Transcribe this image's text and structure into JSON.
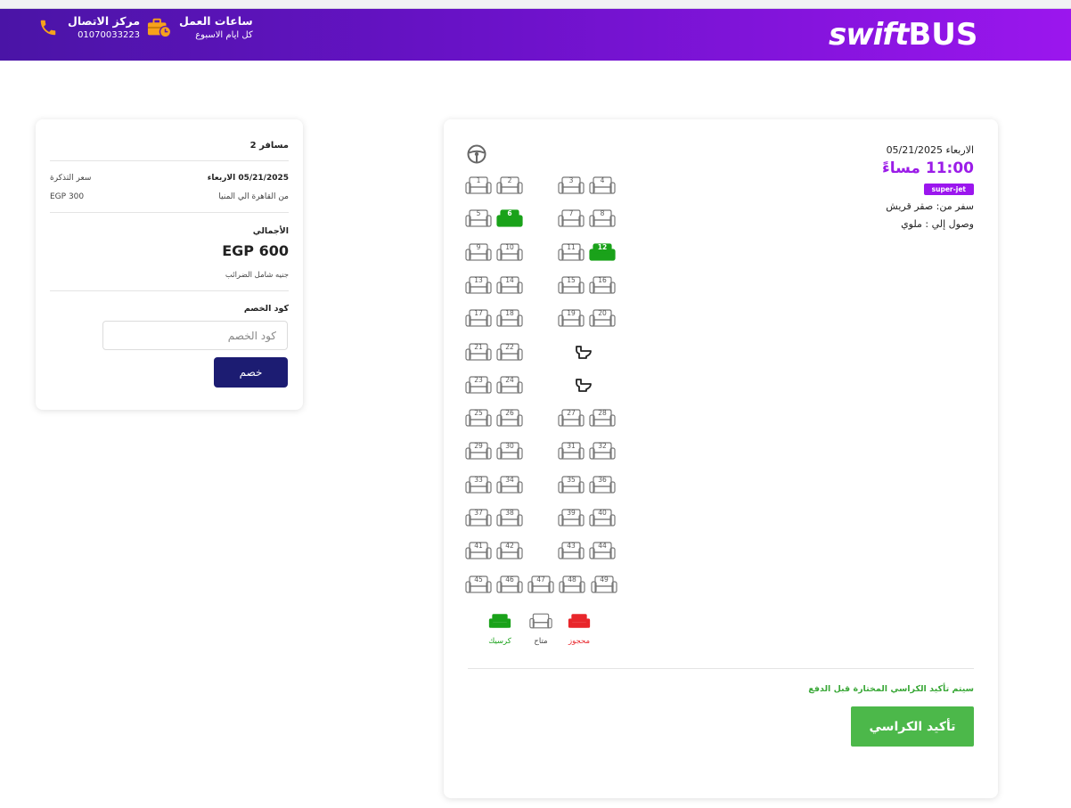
{
  "brand": {
    "logo_text_1": "swift",
    "logo_text_2": "BUS"
  },
  "header": {
    "contact_title": "مركز الاتصال",
    "contact_phone": "01070033223",
    "hours_title": "ساعات العمل",
    "hours_sub": "كل ايام الاسبوع"
  },
  "summary": {
    "passengers": "2 مسافر",
    "date": "05/21/2025 الاربعاء",
    "ticket_price_label": "سعر التذكرة",
    "route": "من القاهرة الي المنيا",
    "ticket_price": "EGP 300",
    "total_label": "الأجمالي",
    "total_value": "EGP 600",
    "tax_note": "جنيه شامل الضرائب",
    "discount_label": "كود الخصم",
    "discount_placeholder": "كود الخصم",
    "discount_button": "خصم"
  },
  "trip": {
    "day": "الاربعاء 05/21/2025",
    "time": "11:00 مساءً",
    "bus_type": "super-jet",
    "from": "سفر من: صقر قريش",
    "to": "وصول إلي : ملوي"
  },
  "seats": {
    "selected": [
      "6",
      "12"
    ],
    "rows": [
      [
        "1",
        "2",
        "",
        "3",
        "4"
      ],
      [
        "5",
        "6",
        "",
        "7",
        "8"
      ],
      [
        "9",
        "10",
        "",
        "11",
        "12"
      ],
      [
        "13",
        "14",
        "",
        "15",
        "16"
      ],
      [
        "17",
        "18",
        "",
        "19",
        "20"
      ],
      [
        "21",
        "22",
        "",
        "WC",
        ""
      ],
      [
        "23",
        "24",
        "",
        "WC",
        ""
      ],
      [
        "25",
        "26",
        "",
        "27",
        "28"
      ],
      [
        "29",
        "30",
        "",
        "31",
        "32"
      ],
      [
        "33",
        "34",
        "",
        "35",
        "36"
      ],
      [
        "37",
        "38",
        "",
        "39",
        "40"
      ],
      [
        "41",
        "42",
        "",
        "43",
        "44"
      ],
      [
        "45",
        "46",
        "47",
        "48",
        "49"
      ]
    ]
  },
  "legend": {
    "booked": "محجوز",
    "available": "متاح",
    "yours": "كرسيك"
  },
  "colors": {
    "selected": "#1aa21a",
    "booked": "#e8262b",
    "available": "#777777",
    "accent": "#9b16ee"
  },
  "footer": {
    "note": "سيتم تأكيد الكراسي المختارة قبل الدفع",
    "confirm_button": "تأكيد الكراسي"
  }
}
